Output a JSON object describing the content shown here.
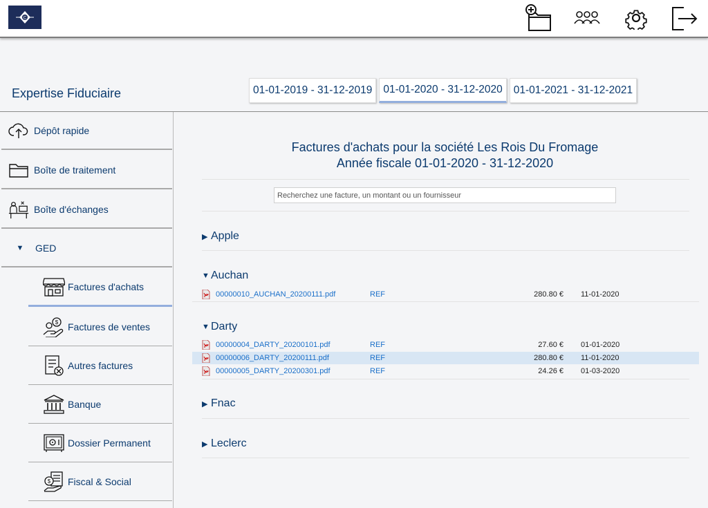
{
  "header": {
    "icons": [
      "new-folder-icon",
      "users-icon",
      "gear-icon",
      "logout-icon"
    ]
  },
  "company": "Expertise Fiduciaire",
  "fiscal_tabs": [
    {
      "label": "01-01-2019 - 31-12-2019",
      "active": false
    },
    {
      "label": "01-01-2020 - 31-12-2020",
      "active": true
    },
    {
      "label": "01-01-2021 - 31-12-2021",
      "active": false
    }
  ],
  "sidebar": {
    "items": [
      {
        "label": "Dépôt rapide",
        "icon": "cloud-upload-icon"
      },
      {
        "label": "Boîte de traitement",
        "icon": "folder-icon"
      },
      {
        "label": "Boîte d'échanges",
        "icon": "desk-icon"
      },
      {
        "label": "GED",
        "icon": "triangle-down-icon"
      }
    ],
    "sub_items": [
      {
        "label": "Factures d'achats",
        "icon": "shop-icon",
        "active": true
      },
      {
        "label": "Factures de ventes",
        "icon": "money-hand-icon"
      },
      {
        "label": "Autres factures",
        "icon": "invoice-x-icon"
      },
      {
        "label": "Banque",
        "icon": "bank-icon"
      },
      {
        "label": "Dossier Permanent",
        "icon": "safe-icon"
      },
      {
        "label": "Fiscal & Social",
        "icon": "tax-icon"
      }
    ]
  },
  "main": {
    "title_line1": "Factures d'achats pour la société Les Rois Du Fromage",
    "title_line2": "Année fiscale 01-01-2020 - 31-12-2020",
    "search_placeholder": "Recherchez une facture, un montant ou un fournisseur",
    "groups": [
      {
        "name": "Apple",
        "expanded": false,
        "rows": []
      },
      {
        "name": "Auchan",
        "expanded": true,
        "rows": [
          {
            "file": "00000010_AUCHAN_20200111.pdf",
            "ref": "REF",
            "amount": "280.80 €",
            "date": "11-01-2020"
          }
        ]
      },
      {
        "name": "Darty",
        "expanded": true,
        "rows": [
          {
            "file": "00000004_DARTY_20200101.pdf",
            "ref": "REF",
            "amount": "27.60 €",
            "date": "01-01-2020"
          },
          {
            "file": "00000006_DARTY_20200111.pdf",
            "ref": "REF",
            "amount": "280.80 €",
            "date": "11-01-2020",
            "highlight": true
          },
          {
            "file": "00000005_DARTY_20200301.pdf",
            "ref": "REF",
            "amount": "24.26 €",
            "date": "01-03-2020"
          }
        ]
      },
      {
        "name": "Fnac",
        "expanded": false,
        "rows": []
      },
      {
        "name": "Leclerc",
        "expanded": false,
        "rows": []
      }
    ]
  },
  "colors": {
    "brand": "#1d2d5a",
    "text": "#0b3a6e",
    "link": "#1a6fc9",
    "highlight": "#d8e6f4",
    "active_underline": "#93aedd"
  }
}
